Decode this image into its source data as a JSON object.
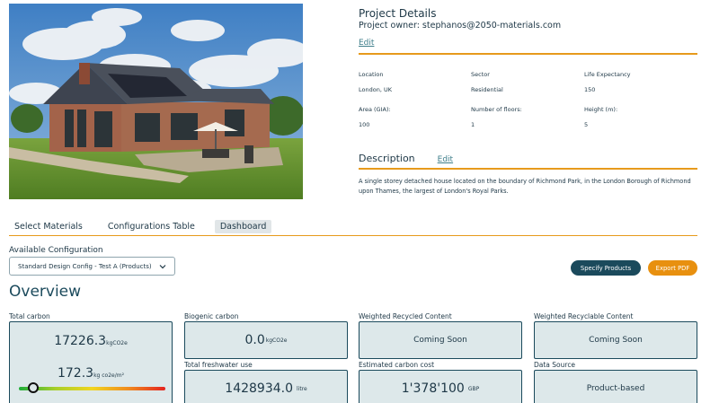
{
  "project": {
    "title": "Project Details",
    "owner": "Project owner: stephanos@2050-materials.com",
    "edit_label": "Edit",
    "properties": [
      {
        "label": "Location",
        "value": "London, UK"
      },
      {
        "label": "Sector",
        "value": "Residential"
      },
      {
        "label": "Life Expectancy",
        "value": "150"
      },
      {
        "label": "Area (GIA):",
        "value": "100"
      },
      {
        "label": "Number of floors:",
        "value": "1"
      },
      {
        "label": "Height (m):",
        "value": "5"
      }
    ],
    "description_title": "Description",
    "description_edit_label": "Edit",
    "description": "A single storey detached house located on the boundary of Richmond Park, in the London Borough of Richmond upon Thames, the largest of London's Royal Parks."
  },
  "tabs": [
    {
      "label": "Select Materials",
      "active": false
    },
    {
      "label": "Configurations Table",
      "active": false
    },
    {
      "label": "Dashboard",
      "active": true
    }
  ],
  "configuration": {
    "label": "Available Configuration",
    "selected": "Standard Design Config - Test A (Products)"
  },
  "buttons": {
    "specify": "Specify Products",
    "export": "Export PDF"
  },
  "overview": {
    "title": "Overview",
    "total_carbon": {
      "label": "Total carbon",
      "value": "17226.3",
      "unit": "kgCO2e",
      "per_area_value": "172.3",
      "per_area_unit": "kg co2e/m²",
      "gauge_fraction": 0.1
    },
    "biogenic_carbon": {
      "label": "Biogenic carbon",
      "value": "0.0",
      "unit": "kgCO2e"
    },
    "weighted_recycled": {
      "label": "Weighted Recycled Content",
      "value": "Coming Soon"
    },
    "weighted_recyclable": {
      "label": "Weighted Recyclable Content",
      "value": "Coming Soon"
    },
    "freshwater": {
      "label": "Total freshwater use",
      "value": "1428934.0",
      "unit": "litre"
    },
    "carbon_cost": {
      "label": "Estimated carbon cost",
      "value": "1'378'100",
      "unit": "GBP"
    },
    "data_source": {
      "label": "Data Source",
      "value": "Product-based"
    }
  },
  "colors": {
    "accent": "#e79a1c",
    "primary": "#1b4a5c",
    "card_bg": "#dde8ea",
    "export_button": "#e8900f"
  }
}
